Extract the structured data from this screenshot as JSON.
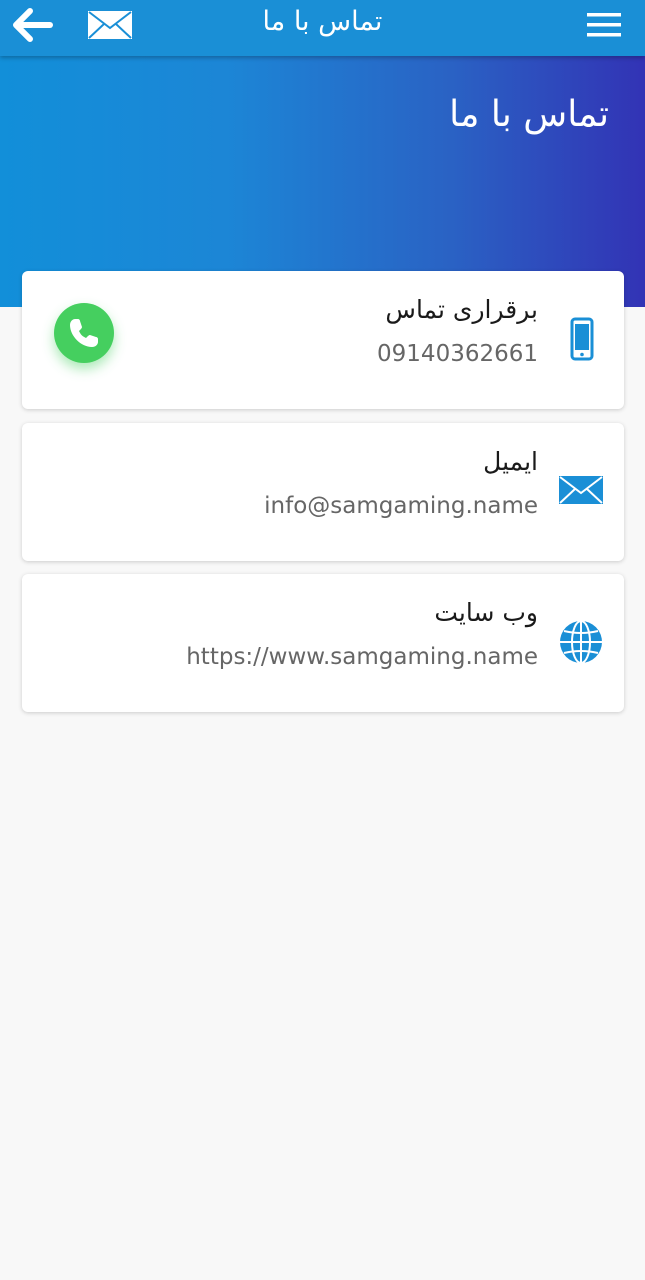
{
  "header": {
    "title": "تماس با ما"
  },
  "hero": {
    "title": "تماس با ما"
  },
  "contacts": [
    {
      "label": "برقراری تماس",
      "value": "09140362661",
      "icon": "phone-icon"
    },
    {
      "label": "ایمیل",
      "value": "info@samgaming.name",
      "icon": "mail-icon"
    },
    {
      "label": "وب سایت",
      "value": "https://www.samgaming.name",
      "icon": "globe-icon"
    }
  ],
  "colors": {
    "topbar": "#1a8fd6",
    "hero_start": "#128fd9",
    "hero_end": "#3233b5",
    "accent_icon": "#1a8fd6",
    "call_button": "#45cf5f"
  }
}
